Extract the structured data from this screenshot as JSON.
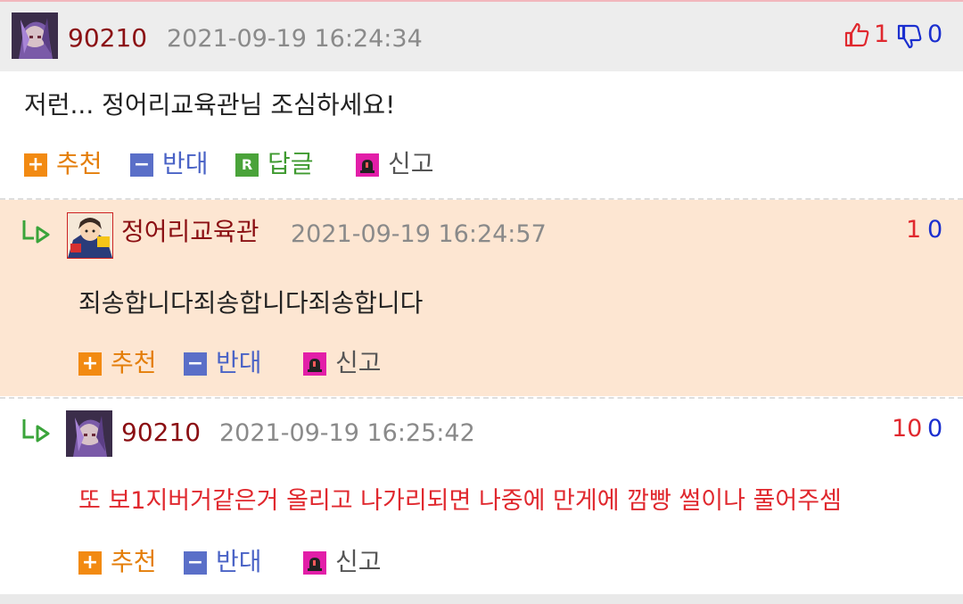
{
  "comments": [
    {
      "nickname": "90210",
      "date": "2021-09-19 16:24:34",
      "up_count": "1",
      "down_count": "0",
      "text": "저런... 정어리교육관님 조심하세요!",
      "avatar_icon": "purple-hair-character-avatar",
      "actions": {
        "recommend": "추천",
        "oppose": "반대",
        "reply": "답글",
        "report": "신고",
        "reply_box": "R"
      }
    },
    {
      "nickname": "정어리교육관",
      "date": "2021-09-19 16:24:57",
      "up_count": "1",
      "down_count": "0",
      "text": "죄송합니다죄송합니다죄송합니다",
      "avatar_icon": "cartoon-character-avatar",
      "actions": {
        "recommend": "추천",
        "oppose": "반대",
        "report": "신고"
      }
    },
    {
      "nickname": "90210",
      "date": "2021-09-19 16:25:42",
      "up_count": "10",
      "down_count": "0",
      "text": "또 보1지버거같은거 올리고 나가리되면 나중에 만게에 깜빵 썰이나 풀어주셈",
      "avatar_icon": "purple-hair-character-avatar",
      "actions": {
        "recommend": "추천",
        "oppose": "반대",
        "report": "신고"
      }
    }
  ],
  "colors": {
    "nickname": "#8b0f13",
    "date": "#8a8a8a",
    "upvote": "#e0282e",
    "downvote": "#1b2fcf",
    "reply_highlight_bg": "#fde6d2",
    "header_bg": "#ededed",
    "highlight_text": "#e0282e"
  }
}
